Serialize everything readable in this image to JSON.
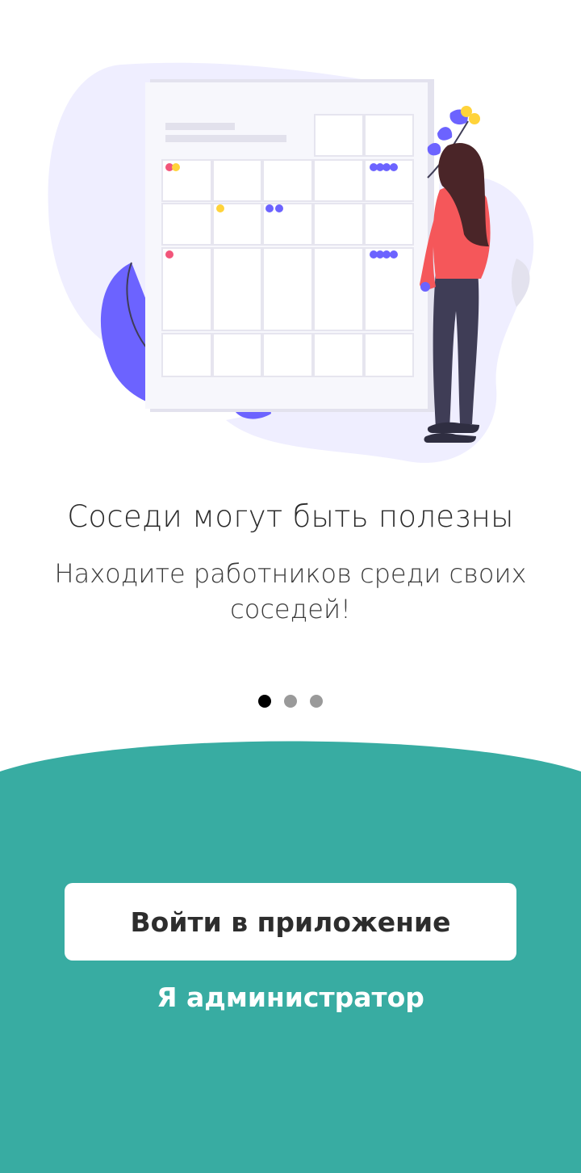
{
  "onboarding": {
    "title": "Соседи могут быть полезны",
    "subtitle": "Находите работников среди своих соседей!",
    "pager": {
      "total": 3,
      "active": 1
    }
  },
  "actions": {
    "login_label": "Войти в приложение",
    "admin_label": "Я администратор"
  },
  "colors": {
    "accent": "#38ACA2",
    "illustration_primary": "#6C63FF",
    "illustration_bg": "#EFEEFF",
    "person_top": "#F5575A",
    "person_pants": "#3F3D56",
    "hair": "#4A2528",
    "calendar_dot_red": "#F2557A",
    "calendar_dot_yellow": "#FFD33A"
  },
  "illustration": {
    "name": "calendar-person-illustration"
  }
}
